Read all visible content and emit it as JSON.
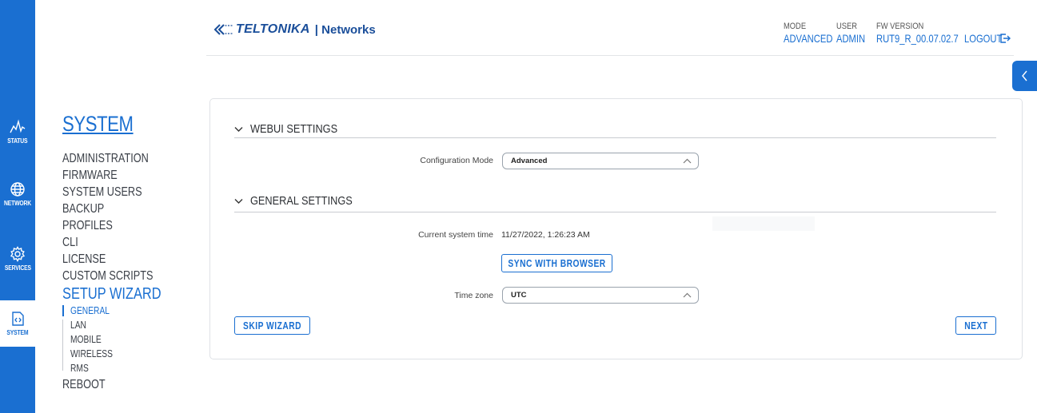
{
  "rail": {
    "items": [
      {
        "label": "STATUS",
        "icon": "status-icon"
      },
      {
        "label": "NETWORK",
        "icon": "globe-icon"
      },
      {
        "label": "SERVICES",
        "icon": "gear-icon"
      },
      {
        "label": "SYSTEM",
        "icon": "code-file-icon"
      }
    ]
  },
  "menu": {
    "title": "SYSTEM",
    "items": [
      "ADMINISTRATION",
      "FIRMWARE",
      "SYSTEM USERS",
      "BACKUP",
      "PROFILES",
      "CLI",
      "LICENSE",
      "CUSTOM SCRIPTS"
    ],
    "setup_wizard": "SETUP WIZARD",
    "wizard_steps": [
      "GENERAL",
      "LAN",
      "MOBILE",
      "WIRELESS",
      "RMS"
    ],
    "reboot": "REBOOT"
  },
  "header": {
    "brand": "TELTONIKA",
    "brand_suffix": "| Networks",
    "mode_label": "MODE",
    "mode_value": "ADVANCED",
    "user_label": "USER",
    "user_value": "ADMIN",
    "fw_label": "FW VERSION",
    "fw_value": "RUT9_R_00.07.02.7",
    "logout": "LOGOUT"
  },
  "webui": {
    "section_title": "WEBUI SETTINGS",
    "config_mode_label": "Configuration Mode",
    "config_mode_value": "Advanced"
  },
  "general": {
    "section_title": "GENERAL SETTINGS",
    "time_label": "Current system time",
    "time_value": "11/27/2022, 1:26:23 AM",
    "sync_button": "SYNC WITH BROWSER",
    "timezone_label": "Time zone",
    "timezone_value": "UTC"
  },
  "footer": {
    "skip_button": "SKIP WIZARD",
    "next_button": "NEXT"
  },
  "colors": {
    "accent": "#1a6fd1",
    "brand": "#1a4e9a"
  }
}
